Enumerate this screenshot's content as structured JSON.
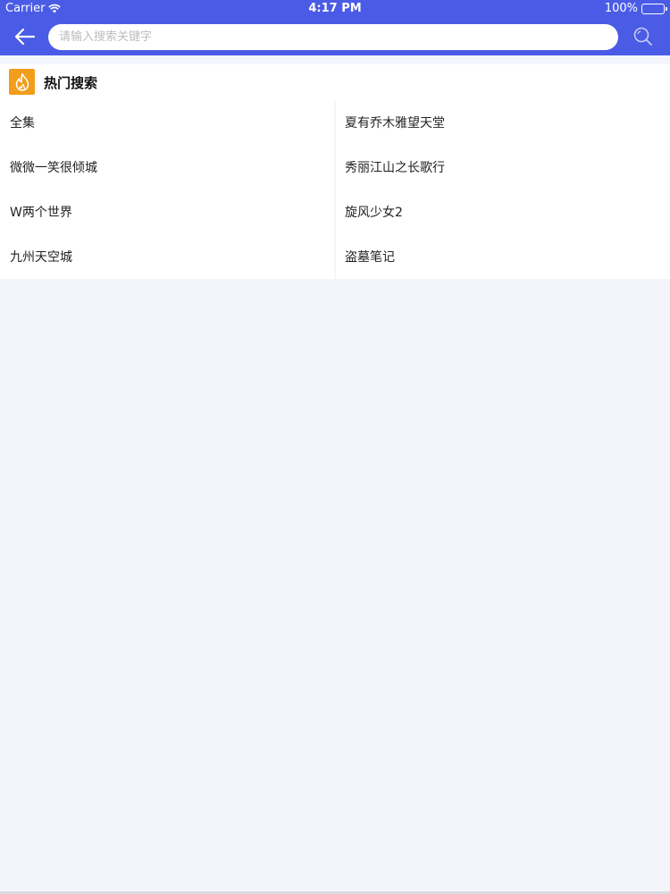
{
  "status_bar": {
    "carrier": "Carrier",
    "time": "4:17 PM",
    "battery": "100%"
  },
  "header": {
    "background": "#4a5ce6",
    "search": {
      "placeholder": "请输入搜索关键字",
      "value": ""
    }
  },
  "hot_search": {
    "title": "热门搜索",
    "accent": "#f29d1b",
    "icon": "fire-icon",
    "items": [
      "全集",
      "夏有乔木雅望天堂",
      "微微一笑很倾城",
      "秀丽江山之长歌行",
      "W两个世界",
      "旋风少女2",
      "九州天空城",
      "盗墓笔记"
    ]
  }
}
